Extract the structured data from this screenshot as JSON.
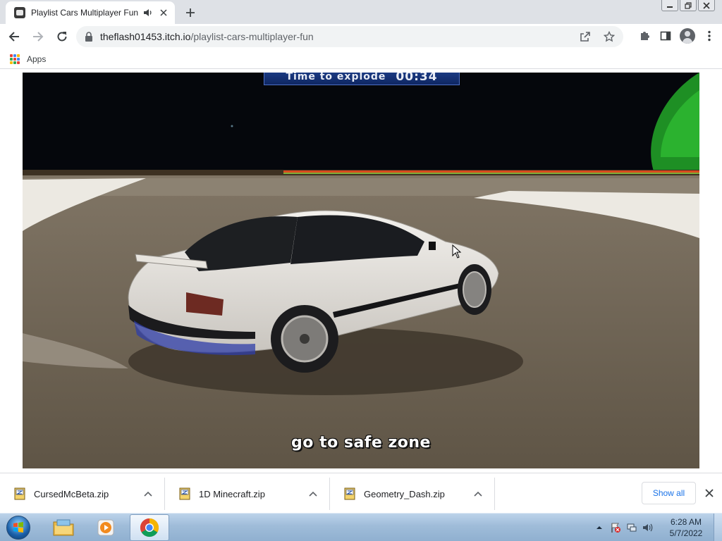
{
  "browser": {
    "tab": {
      "title": "Playlist Cars Multiplayer Fun",
      "audio_icon": "speaker-icon",
      "close_icon": "close-icon"
    },
    "new_tab_icon": "plus-icon",
    "window_controls": [
      "minimize-icon",
      "restore-icon",
      "close-icon"
    ],
    "url": {
      "host": "theflash01453.itch.io",
      "path": "/playlist-cars-multiplayer-fun"
    },
    "bookmarks": [
      {
        "label": "Apps",
        "icon": "apps-grid-icon"
      }
    ]
  },
  "game": {
    "hud_timer_label": "Time to explode",
    "hud_timer_value": "00:34",
    "hud_message": "go to safe zone"
  },
  "downloads": {
    "items": [
      {
        "name": "CursedMcBeta.zip"
      },
      {
        "name": "1D Minecraft.zip"
      },
      {
        "name": "Geometry_Dash.zip"
      }
    ],
    "show_all": "Show all"
  },
  "taskbar": {
    "apps": [
      "file-explorer-icon",
      "media-player-icon",
      "chrome-icon"
    ],
    "clock_time": "6:28 AM",
    "clock_date": "5/7/2022"
  },
  "colors": {
    "tabstrip": "#dee1e6",
    "link": "#1a73e8",
    "sky": "#05070c",
    "ground": "#6d6252"
  }
}
